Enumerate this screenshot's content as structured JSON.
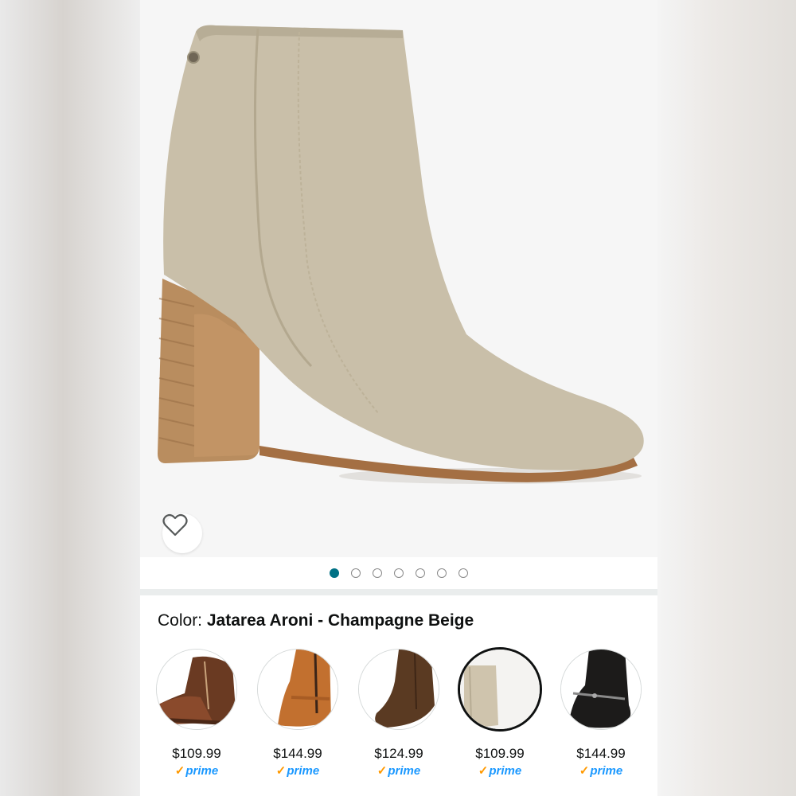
{
  "product": {
    "color_label": "Color:",
    "color_value": "Jatarea Aroni - Champagne Beige"
  },
  "gallery": {
    "total_images": 7,
    "active_index": 0
  },
  "icons": {
    "favorite": "heart-outline-icon",
    "prime_check": "checkmark-icon"
  },
  "colors": {
    "accent_dot": "#007185",
    "prime_blue": "#1a98ff",
    "prime_check": "#ff9900"
  },
  "swatches": [
    {
      "price": "$109.99",
      "prime": "prime",
      "selected": false
    },
    {
      "price": "$144.99",
      "prime": "prime",
      "selected": false
    },
    {
      "price": "$124.99",
      "prime": "prime",
      "selected": false
    },
    {
      "price": "$109.99",
      "prime": "prime",
      "selected": true
    },
    {
      "price": "$144.99",
      "prime": "prime",
      "selected": false
    }
  ]
}
